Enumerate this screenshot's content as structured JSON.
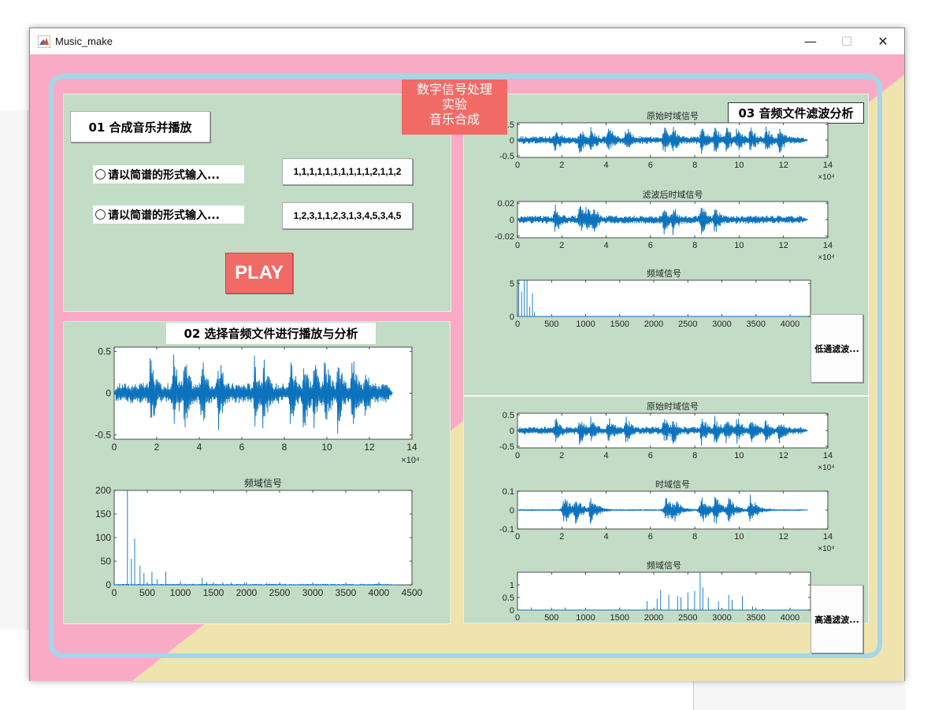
{
  "window": {
    "title": "Music_make",
    "minimize": "—",
    "maximize": "☐",
    "close": "✕"
  },
  "banner": {
    "line1": "数字信号处理",
    "line2": "实验",
    "line3": "音乐合成"
  },
  "panel1": {
    "title": "01 合成音乐并播放",
    "radio1_label": "请以简谱的形式输入...",
    "radio2_label": "请以简谱的形式输入...",
    "seq1": "1,1,1,1,1,1,1,1,1,1,2,1,1,2",
    "seq2": "1,2,3,1,1,2,3,1,3,4,5,3,4,5",
    "play_label": "PLAY"
  },
  "panel2": {
    "title": "02 选择音频文件进行播放与分析"
  },
  "panel3": {
    "title": "03 音频文件滤波分析",
    "lowpass_label": "低通滤波...",
    "highpass_label": "高通滤波..."
  },
  "colors": {
    "pink": "#f9abc6",
    "yellow": "#efe4ad",
    "panel": "#c2dcc6",
    "accent": "#f26a66",
    "frame": "#a3d7ea",
    "line": "#0b72bd"
  },
  "chart_data": [
    {
      "id": "p2_time",
      "type": "line",
      "title": "",
      "xlim": [
        0,
        14
      ],
      "ylim": [
        -0.55,
        0.55
      ],
      "xticks": [
        "0",
        "2",
        "4",
        "6",
        "8",
        "10",
        "12",
        "14"
      ],
      "yticks": [
        "-0.5",
        "0",
        "0.5"
      ],
      "x_multiplier": "×10⁴",
      "series": [
        {
          "kind": "waveform",
          "x_end": 13.1,
          "amp_peak": 0.5,
          "peaks": [
            1.7,
            2.8,
            3.3,
            4.1,
            4.9,
            6.6,
            7.0,
            8.3,
            8.9,
            9.4,
            9.9,
            10.5,
            11.2,
            11.8
          ]
        }
      ]
    },
    {
      "id": "p2_freq",
      "type": "line",
      "title": "频域信号",
      "xlim": [
        0,
        4500
      ],
      "ylim": [
        0,
        200
      ],
      "xticks": [
        "0",
        "500",
        "1000",
        "1500",
        "2000",
        "2500",
        "3000",
        "3500",
        "4000",
        "4500"
      ],
      "yticks": [
        "0",
        "50",
        "100",
        "150",
        "200"
      ],
      "series": [
        {
          "kind": "spikes",
          "spikes": [
            [
              200,
              200
            ],
            [
              260,
              55
            ],
            [
              310,
              98
            ],
            [
              390,
              40
            ],
            [
              450,
              25
            ],
            [
              570,
              28
            ],
            [
              650,
              12
            ],
            [
              780,
              28
            ],
            [
              1000,
              8
            ],
            [
              1330,
              15
            ],
            [
              1400,
              6
            ],
            [
              1640,
              5
            ],
            [
              1770,
              5
            ],
            [
              1970,
              5
            ],
            [
              2300,
              4
            ]
          ]
        }
      ]
    },
    {
      "id": "p3_orig_a",
      "type": "line",
      "title": "原始时域信号",
      "xlim": [
        0,
        14
      ],
      "ylim": [
        -0.55,
        0.55
      ],
      "xticks": [
        "0",
        "2",
        "4",
        "6",
        "8",
        "10",
        "12",
        "14"
      ],
      "yticks": [
        "-0.5",
        "0",
        "0.5"
      ],
      "x_multiplier": "×10⁴",
      "series": [
        {
          "kind": "waveform",
          "x_end": 13.1,
          "amp_peak": 0.5,
          "peaks": [
            1.7,
            2.8,
            3.3,
            4.1,
            4.9,
            6.6,
            7.0,
            8.3,
            8.9,
            9.4,
            9.9,
            10.5,
            11.2,
            11.8
          ]
        }
      ]
    },
    {
      "id": "p3_filtered",
      "type": "line",
      "title": "滤波后时域信号",
      "xlim": [
        0,
        14
      ],
      "ylim": [
        -0.022,
        0.022
      ],
      "xticks": [
        "0",
        "2",
        "4",
        "6",
        "8",
        "10",
        "12",
        "14"
      ],
      "yticks": [
        "-0.02",
        "0",
        "0.02"
      ],
      "x_multiplier": "×10⁴",
      "series": [
        {
          "kind": "waveform",
          "x_end": 13.1,
          "amp_peak": 0.02,
          "peaks": [
            1.7,
            2.8,
            3.1,
            3.4,
            6.6,
            7.0,
            8.3,
            8.9
          ]
        }
      ]
    },
    {
      "id": "p3_freq_low",
      "type": "line",
      "title": "频域信号",
      "xlim": [
        0,
        4300
      ],
      "ylim": [
        0,
        5.5
      ],
      "xticks": [
        "0",
        "500",
        "1000",
        "1500",
        "2000",
        "2500",
        "3000",
        "3500",
        "4000"
      ],
      "yticks": [
        "0",
        "5"
      ],
      "series": [
        {
          "kind": "spikes",
          "spikes": [
            [
              20,
              5.5
            ],
            [
              60,
              3.8
            ],
            [
              100,
              5.5
            ],
            [
              140,
              5.5
            ],
            [
              180,
              1.5
            ],
            [
              220,
              3.5
            ],
            [
              250,
              0.6
            ]
          ]
        }
      ]
    },
    {
      "id": "p3_orig_b",
      "type": "line",
      "title": "原始时域信号",
      "xlim": [
        0,
        14
      ],
      "ylim": [
        -0.55,
        0.55
      ],
      "xticks": [
        "0",
        "2",
        "4",
        "6",
        "8",
        "10",
        "12",
        "14"
      ],
      "yticks": [
        "-0.5",
        "0",
        "0.5"
      ],
      "x_multiplier": "×10⁴",
      "series": [
        {
          "kind": "waveform",
          "x_end": 13.1,
          "amp_peak": 0.5,
          "peaks": [
            1.7,
            2.8,
            3.3,
            4.1,
            4.9,
            6.6,
            7.0,
            8.3,
            8.9,
            9.4,
            9.9,
            10.5,
            11.2,
            11.8
          ]
        }
      ]
    },
    {
      "id": "p3_time_high",
      "type": "line",
      "title": "时域信号",
      "xlim": [
        0,
        14
      ],
      "ylim": [
        -0.1,
        0.1
      ],
      "xticks": [
        "0",
        "2",
        "4",
        "6",
        "8",
        "10",
        "12",
        "14"
      ],
      "yticks": [
        "-0.1",
        "0",
        "0.1"
      ],
      "x_multiplier": "×10⁴",
      "series": [
        {
          "kind": "waveform",
          "x_end": 13.1,
          "amp_peak": 0.09,
          "sparse": true,
          "peaks": [
            2.1,
            2.6,
            3.3,
            6.7,
            7.0,
            8.3,
            8.9,
            9.5,
            10.5
          ]
        }
      ]
    },
    {
      "id": "p3_freq_high",
      "type": "line",
      "title": "频域信号",
      "xlim": [
        0,
        4300
      ],
      "ylim": [
        0,
        1.5
      ],
      "xticks": [
        "0",
        "500",
        "1000",
        "1500",
        "2000",
        "2500",
        "3000",
        "3500",
        "4000"
      ],
      "yticks": [
        "0",
        "0.5",
        "1"
      ],
      "series": [
        {
          "kind": "spikes",
          "spikes": [
            [
              200,
              0.1
            ],
            [
              700,
              0.1
            ],
            [
              1500,
              0.1
            ],
            [
              1900,
              0.35
            ],
            [
              2050,
              0.45
            ],
            [
              2100,
              0.8
            ],
            [
              2220,
              0.6
            ],
            [
              2350,
              0.55
            ],
            [
              2400,
              0.5
            ],
            [
              2500,
              0.7
            ],
            [
              2600,
              0.75
            ],
            [
              2680,
              1.5
            ],
            [
              2720,
              0.9
            ],
            [
              2800,
              0.5
            ],
            [
              2950,
              0.35
            ],
            [
              3100,
              0.6
            ],
            [
              3150,
              0.4
            ],
            [
              3300,
              0.55
            ],
            [
              3450,
              0.15
            ],
            [
              3600,
              0.05
            ]
          ]
        }
      ]
    }
  ]
}
